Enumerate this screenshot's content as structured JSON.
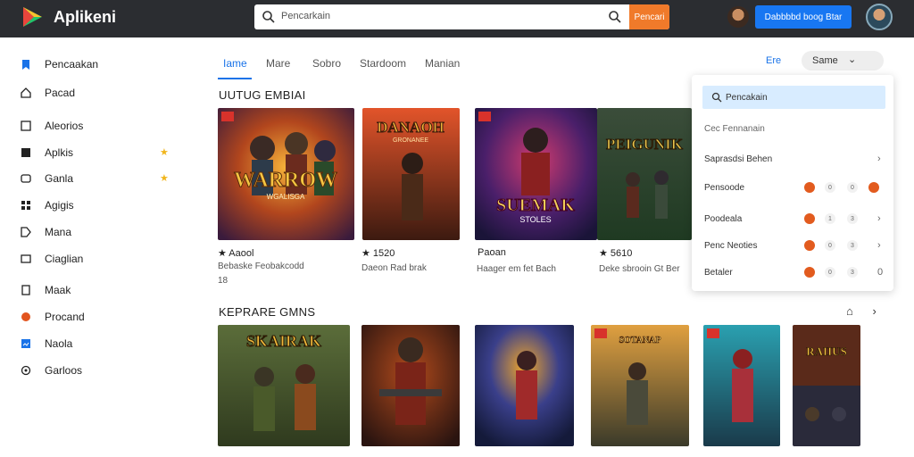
{
  "app": {
    "title": "Aplikeni"
  },
  "search": {
    "placeholder": "Pencarkain",
    "button": "Pencari"
  },
  "header": {
    "cta": "Dabbbbd boog Btar"
  },
  "sidebar": {
    "items": [
      {
        "label": "Pencaakan",
        "icon": "bookmark-icon",
        "color": "#1a73e8"
      },
      {
        "label": "Pacad",
        "icon": "home-icon",
        "color": "#222"
      },
      {
        "label": "Aleorios",
        "icon": "grid-icon",
        "color": "#222"
      },
      {
        "label": "Aplkis",
        "icon": "apps-icon",
        "color": "#222",
        "starred": true
      },
      {
        "label": "Ganla",
        "icon": "gamepad-icon",
        "color": "#222",
        "starred": true
      },
      {
        "label": "Agigis",
        "icon": "grid-small-icon",
        "color": "#222"
      },
      {
        "label": "Mana",
        "icon": "tag-icon",
        "color": "#222"
      },
      {
        "label": "Ciaglian",
        "icon": "card-icon",
        "color": "#222"
      },
      {
        "label": "Maak",
        "icon": "book-icon",
        "color": "#222"
      },
      {
        "label": "Procand",
        "icon": "flame-icon",
        "color": "#e2541e"
      },
      {
        "label": "Naola",
        "icon": "chart-icon",
        "color": "#1a73e8"
      },
      {
        "label": "Garloos",
        "icon": "gear-icon",
        "color": "#222"
      }
    ],
    "star": "★"
  },
  "tabs": [
    {
      "label": "Iame",
      "active": true
    },
    {
      "label": "Mare"
    },
    {
      "label": "Sobro"
    },
    {
      "label": "Stardoom"
    },
    {
      "label": "Manian"
    }
  ],
  "right_tab": "Ere",
  "sort": {
    "value": "Same",
    "chevron": "⌄"
  },
  "section1": {
    "title": "UUTUG EMBIAI",
    "cards": [
      {
        "line1": "★ Aaool",
        "line2": "Bebaske Feobakcodd",
        "line3": "18"
      },
      {
        "line1": "★ 1520",
        "line2": "Daeon Rad brak"
      },
      {
        "line1": "Paoan",
        "line2": "Haager em fet Bach"
      },
      {
        "line1": "★ 5610",
        "line2": "Deke sbrooin Gt Ber"
      }
    ],
    "card_titles": [
      "WARROW",
      "DANAOH",
      "SUEMAK",
      "PEIGUNIK"
    ],
    "card_subs": [
      "WGALISGA",
      "GRONANEE",
      "STOLES",
      ""
    ]
  },
  "section2": {
    "title": "KEPRARE GMNS",
    "card_titles": [
      "SKAIRAK",
      "",
      "",
      "SOTANAP",
      "",
      "RAIIUS"
    ]
  },
  "dropdown": {
    "search": "Pencakain",
    "rows": [
      {
        "label": "Cec Fennanain"
      },
      {
        "label": "Saprasdsi Behen",
        "chevron": "›"
      },
      {
        "label": "Pensoode",
        "dots": [
          "0",
          "0"
        ]
      },
      {
        "label": "Poodeala",
        "dots": [
          "1",
          "3"
        ],
        "chevron": "›"
      },
      {
        "label": "Penc Neoties",
        "dots": [
          "0",
          "3"
        ],
        "chevron": "›"
      },
      {
        "label": "Betaler",
        "dots": [
          "0",
          "3"
        ],
        "chevron": "0"
      }
    ]
  },
  "colors": {
    "accent": "#1a73e8",
    "topbar": "#2b2d31",
    "search_button": "#f07a2a",
    "badge": "#d8322b"
  }
}
